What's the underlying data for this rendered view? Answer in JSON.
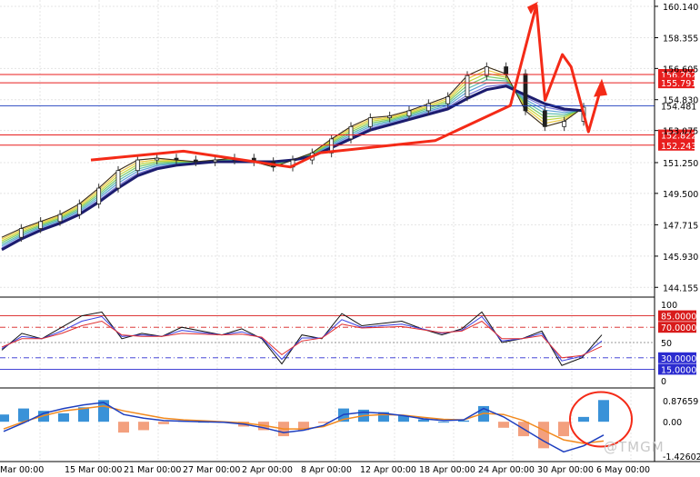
{
  "watermark": "@TMGM",
  "colors": {
    "background": "#ffffff",
    "grid": "#e4e4e4",
    "axis": "#000000",
    "level": "#e81e1e",
    "current": "#1f3fbf",
    "annotation": "#f42a17",
    "ma_slow": "#1c1c6e",
    "hist_pos": "#3a92d8",
    "hist_neg": "#f3a07e",
    "macd_line": "#1e3fbf",
    "signal_line": "#f28a1e",
    "rsi_black": "#111111",
    "rsi_blue": "#3a40e0",
    "rsi_red": "#e03030",
    "rsi_level_red": "#d81b1b",
    "rsi_level_blue": "#2b2bd0"
  },
  "chart_data": [
    {
      "type": "line",
      "title": "",
      "note": "candlestick price chart with moving-average ribbon",
      "x_ticks": [
        "Mar 00:00",
        "15 Mar 00:00",
        "21 Mar 00:00",
        "27 Mar 00:00",
        "2 Apr 00:00",
        "8 Apr 00:00",
        "12 Apr 00:00",
        "18 Apr 00:00",
        "24 Apr 00:00",
        "30 Apr 00:00",
        "6 May 00:00"
      ],
      "y_ticks": [
        "160.140",
        "158.355",
        "156.605",
        "154.830",
        "153.075",
        "151.250",
        "149.500",
        "147.715",
        "145.930",
        "144.155"
      ],
      "ylim": [
        143.6,
        160.5
      ],
      "levels": [
        {
          "label": "156.262",
          "value": 156.262
        },
        {
          "label": "155.791",
          "value": 155.791
        },
        {
          "label": "152.822",
          "value": 152.822
        },
        {
          "label": "152.243",
          "value": 152.243
        }
      ],
      "current": {
        "label": "154.481",
        "value": 154.481
      },
      "series": [
        {
          "values": [
            147.0,
            147.5,
            147.9,
            148.3,
            148.9,
            149.8,
            150.8,
            151.4,
            151.5,
            151.4,
            151.3,
            151.4,
            151.5,
            151.3,
            151.0,
            151.4,
            151.8,
            152.6,
            153.3,
            153.8,
            153.9,
            154.2,
            154.6,
            155.0,
            156.2,
            156.7,
            156.3,
            154.2,
            153.3,
            153.6,
            154.4
          ]
        },
        {
          "values": [
            146.3,
            146.9,
            147.4,
            147.8,
            148.3,
            149.0,
            149.8,
            150.5,
            150.9,
            151.1,
            151.2,
            151.3,
            151.3,
            151.3,
            151.3,
            151.4,
            151.6,
            152.1,
            152.6,
            153.1,
            153.4,
            153.7,
            154.0,
            154.3,
            154.9,
            155.4,
            155.6,
            155.1,
            154.6,
            154.3,
            154.2
          ]
        }
      ],
      "annotation_path": [
        {
          "x": 31,
          "y": 151.4
        },
        {
          "x": 63,
          "y": 151.9
        },
        {
          "x": 100,
          "y": 151.0
        },
        {
          "x": 110,
          "y": 151.8
        },
        {
          "x": 150,
          "y": 152.5
        },
        {
          "x": 176,
          "y": 154.5
        },
        {
          "x": 185,
          "y": 160.2
        },
        {
          "x": 188,
          "y": 154.8
        },
        {
          "x": 194,
          "y": 157.4
        },
        {
          "x": 197,
          "y": 156.7
        },
        {
          "x": 203,
          "y": 153.0
        },
        {
          "x": 207,
          "y": 155.3
        }
      ]
    },
    {
      "type": "line",
      "title": "",
      "note": "stochastic-style oscillator",
      "y_ticks": [
        "100",
        "85.0000",
        "70.0000",
        "50",
        "30.0000",
        "15.0000",
        "0"
      ],
      "ylim": [
        0,
        100
      ],
      "levels": [
        {
          "label": "85.0000",
          "value": 85
        },
        {
          "label": "70.0000",
          "value": 70
        },
        {
          "label": "30.0000",
          "value": 30
        },
        {
          "label": "15.0000",
          "value": 15
        }
      ],
      "series": [
        {
          "values": [
            40,
            62,
            55,
            70,
            85,
            90,
            55,
            62,
            58,
            70,
            65,
            60,
            68,
            55,
            22,
            60,
            55,
            88,
            72,
            75,
            78,
            68,
            60,
            68,
            90,
            50,
            55,
            65,
            20,
            30,
            60
          ]
        },
        {
          "values": [
            42,
            58,
            55,
            65,
            78,
            84,
            58,
            60,
            58,
            66,
            63,
            60,
            64,
            56,
            28,
            56,
            56,
            80,
            70,
            72,
            74,
            68,
            62,
            66,
            84,
            52,
            55,
            62,
            26,
            32,
            52
          ]
        },
        {
          "values": [
            44,
            55,
            55,
            62,
            72,
            78,
            60,
            58,
            58,
            62,
            61,
            60,
            61,
            57,
            34,
            52,
            56,
            74,
            69,
            70,
            71,
            67,
            63,
            65,
            78,
            55,
            55,
            59,
            30,
            33,
            45
          ]
        }
      ]
    },
    {
      "type": "bar",
      "title": "",
      "note": "MACD histogram with MACD and signal lines",
      "y_ticks": [
        "0.87659",
        "0.00",
        "-1.42602"
      ],
      "ylim": [
        -1.42602,
        1.1
      ],
      "values": [
        0.3,
        0.55,
        0.45,
        0.35,
        0.6,
        0.9,
        -0.45,
        -0.35,
        -0.1,
        0.05,
        0.0,
        -0.05,
        -0.2,
        -0.35,
        -0.6,
        -0.35,
        -0.05,
        0.55,
        0.5,
        0.4,
        0.25,
        0.1,
        0.0,
        0.05,
        0.65,
        -0.25,
        -0.6,
        -1.1,
        -0.6,
        0.2,
        0.9
      ],
      "series": [
        {
          "values": [
            -0.4,
            -0.05,
            0.35,
            0.55,
            0.7,
            0.8,
            0.3,
            0.15,
            0.05,
            0.02,
            0.0,
            -0.02,
            -0.1,
            -0.25,
            -0.45,
            -0.35,
            -0.15,
            0.3,
            0.4,
            0.35,
            0.25,
            0.12,
            0.05,
            0.08,
            0.55,
            0.2,
            -0.3,
            -0.8,
            -1.25,
            -1.0,
            -0.55
          ]
        },
        {
          "values": [
            -0.3,
            0.0,
            0.25,
            0.45,
            0.55,
            0.65,
            0.45,
            0.3,
            0.15,
            0.08,
            0.04,
            0.0,
            -0.05,
            -0.15,
            -0.3,
            -0.3,
            -0.2,
            0.1,
            0.25,
            0.3,
            0.27,
            0.18,
            0.1,
            0.08,
            0.35,
            0.3,
            0.05,
            -0.35,
            -0.75,
            -0.9,
            -0.8
          ]
        }
      ]
    }
  ]
}
